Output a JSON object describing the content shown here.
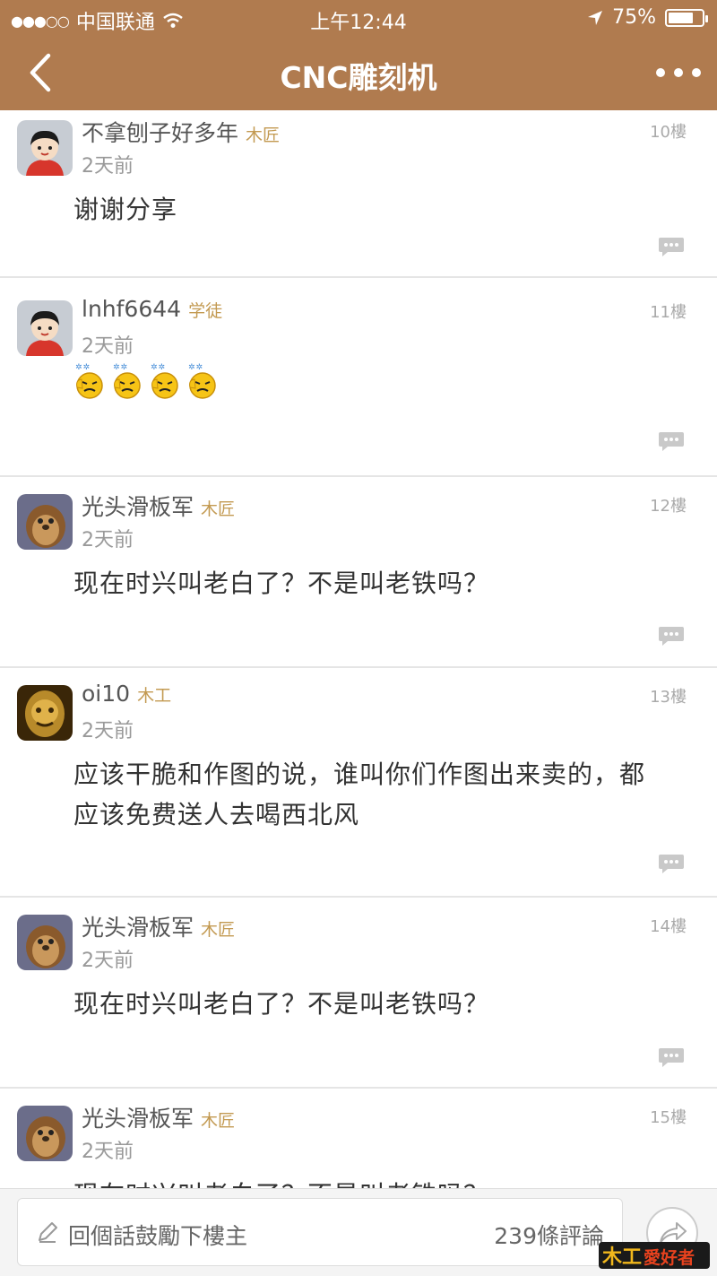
{
  "status_bar": {
    "signal_dots": "●●●○○",
    "carrier": "中国联通",
    "time": "上午12:44",
    "battery_percent": "75%",
    "battery_level": 0.75
  },
  "nav": {
    "title": "CNC雕刻机",
    "back_icon": "chevron-left-icon",
    "more_icon": "more-dots-icon"
  },
  "colors": {
    "header_bg": "#b07b4f",
    "badge": "#c39a52"
  },
  "posts": [
    {
      "name": "不拿刨子好多年",
      "badge": "木匠",
      "time": "2天前",
      "floor": "10樓",
      "content": "谢谢分享",
      "avatar": "cartoon-boy-avatar"
    },
    {
      "name": "lnhf6644",
      "badge": "学徒",
      "time": "2天前",
      "floor": "11樓",
      "content": "",
      "emoji": "applause-emoji",
      "emoji_count": 4,
      "avatar": "cartoon-boy-avatar"
    },
    {
      "name": "光头滑板军",
      "badge": "木匠",
      "time": "2天前",
      "floor": "12樓",
      "content": "现在时兴叫老白了？不是叫老铁吗？",
      "avatar": "hedgehog-avatar"
    },
    {
      "name": "oi10",
      "badge": "木工",
      "time": "2天前",
      "floor": "13樓",
      "content": "应该干脆和作图的说，谁叫你们作图出来卖的，都应该免费送人去喝西北风",
      "avatar": "golden-mask-avatar"
    },
    {
      "name": "光头滑板军",
      "badge": "木匠",
      "time": "2天前",
      "floor": "14樓",
      "content": "现在时兴叫老白了？不是叫老铁吗？",
      "avatar": "hedgehog-avatar"
    },
    {
      "name": "光头滑板军",
      "badge": "木匠",
      "time": "2天前",
      "floor": "15樓",
      "content": "现在时兴叫老白了？不是叫老铁吗？",
      "avatar": "hedgehog-avatar"
    }
  ],
  "bottom_bar": {
    "placeholder": "回個話鼓勵下樓主",
    "comment_count": "239條評論",
    "share_icon": "share-arrow-icon"
  },
  "watermark": {
    "text": "木工愛好者"
  }
}
